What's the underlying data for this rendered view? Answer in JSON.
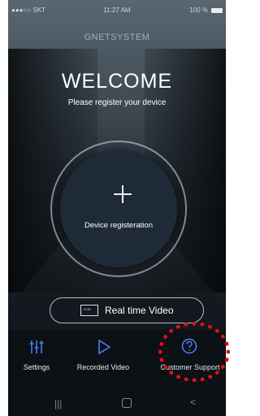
{
  "status": {
    "signal": "●●●○○ SKT",
    "wifi": "wifi-icon",
    "time": "11:27 AM",
    "battery": "100 %"
  },
  "brand": "GNETSYSTEM",
  "welcome": {
    "title": "WELCOME",
    "subtitle": "Please register your device"
  },
  "register": {
    "label": "Device registeration",
    "icon": "plus-icon"
  },
  "realtime": {
    "label": "Real time Video",
    "icon_text": "LIVE"
  },
  "bottom_nav": [
    {
      "label": "Settings",
      "icon": "sliders-icon"
    },
    {
      "label": "Recorded Video",
      "icon": "play-icon"
    },
    {
      "label": "Customer Support",
      "icon": "question-circle-icon"
    }
  ],
  "system_nav": {
    "recent": "|||",
    "home": "",
    "back": "<"
  },
  "colors": {
    "accent": "#4b83ff",
    "highlight": "#e11212"
  }
}
